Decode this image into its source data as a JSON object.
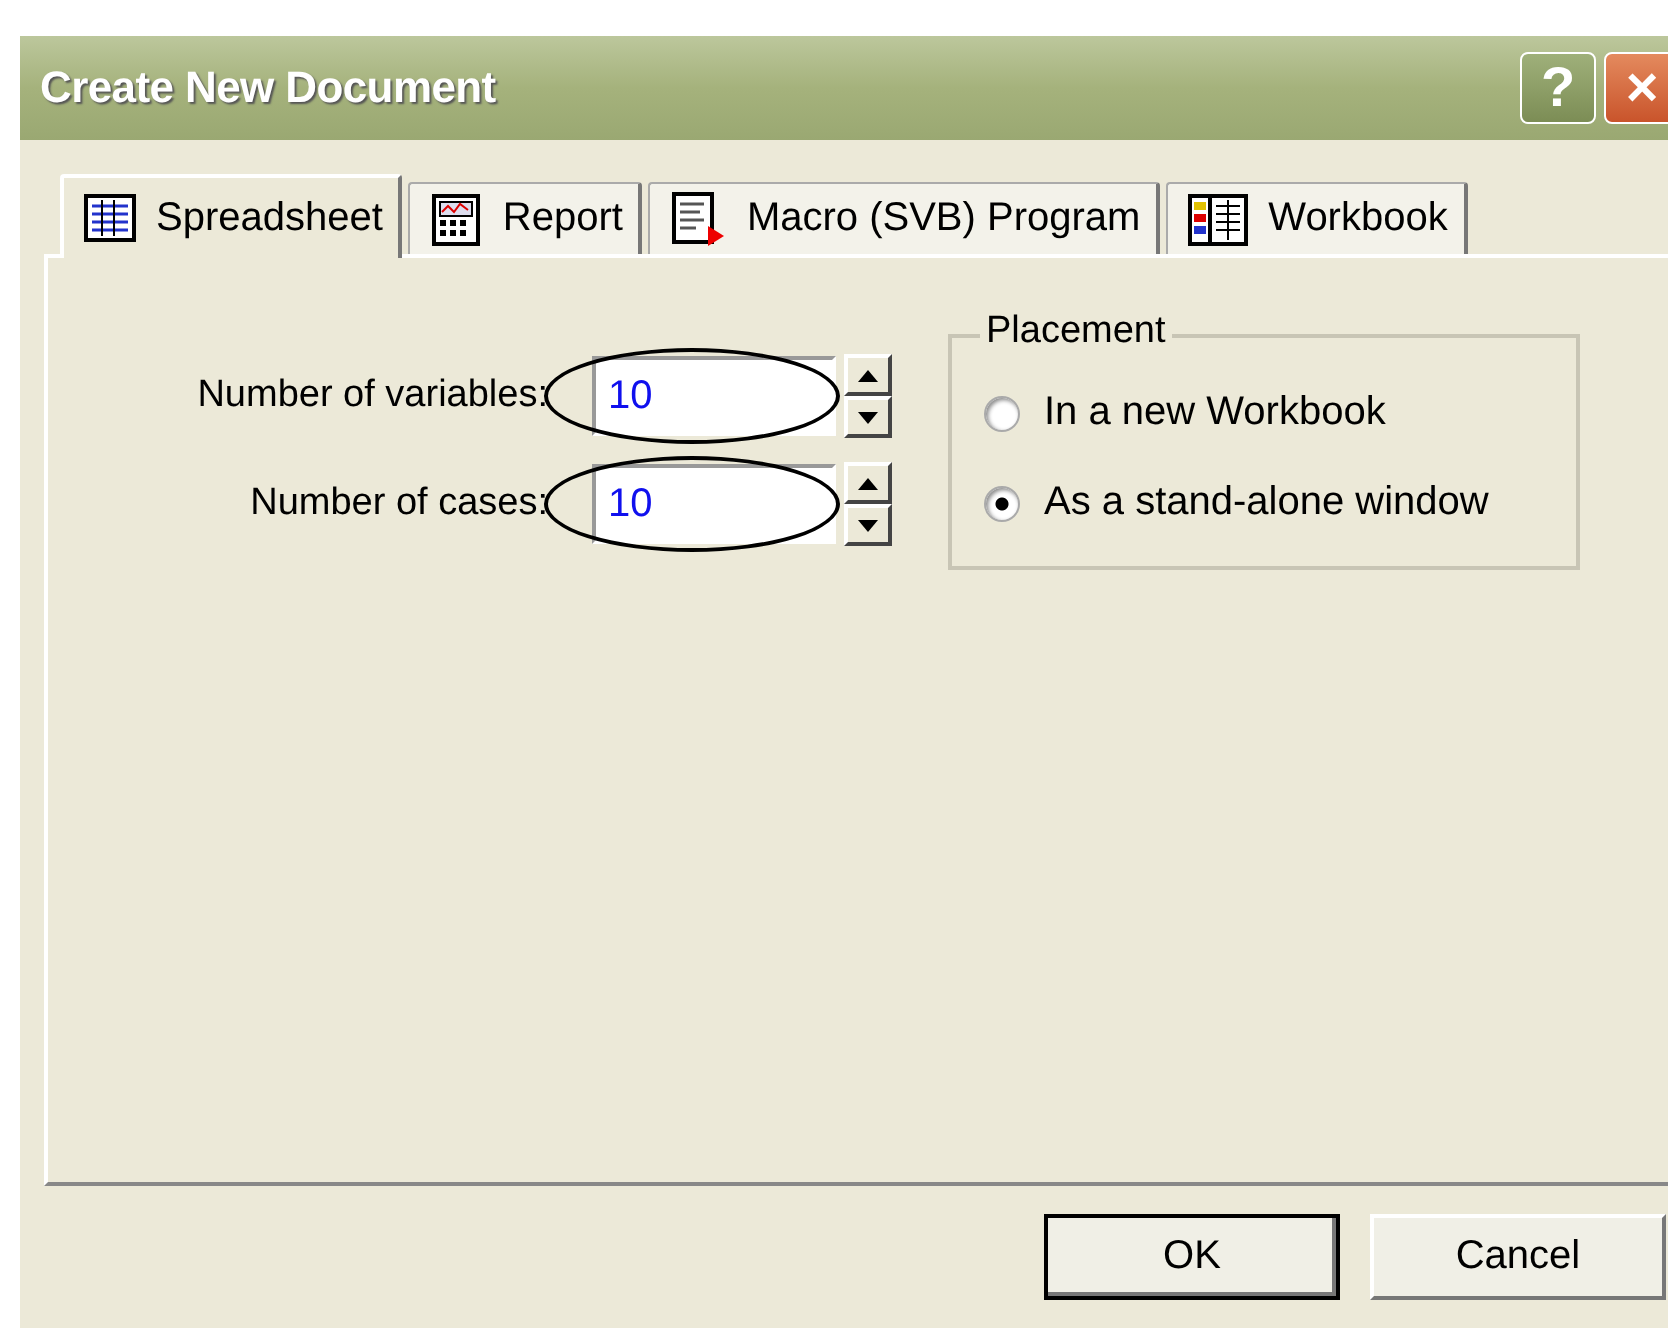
{
  "window": {
    "title": "Create New Document",
    "buttons": [
      "?",
      "×"
    ]
  },
  "tabs": [
    {
      "label": "Spreadsheet",
      "selected": true
    },
    {
      "label": "Report",
      "selected": false
    },
    {
      "label": "Macro (SVB) Program",
      "selected": false
    },
    {
      "label": "Workbook",
      "selected": false
    }
  ],
  "fields": [
    {
      "label": "Number of variables:",
      "value": "10",
      "circled": true
    },
    {
      "label": "Number of cases:",
      "value": "10",
      "circled": true
    }
  ],
  "placement": {
    "title": "Placement",
    "options": [
      {
        "label": "In a new Workbook",
        "selected": false
      },
      {
        "label": "As a stand-alone window",
        "selected": true
      }
    ]
  },
  "buttons": [
    {
      "label": "OK",
      "default": true
    },
    {
      "label": "Cancel",
      "default": false
    }
  ]
}
